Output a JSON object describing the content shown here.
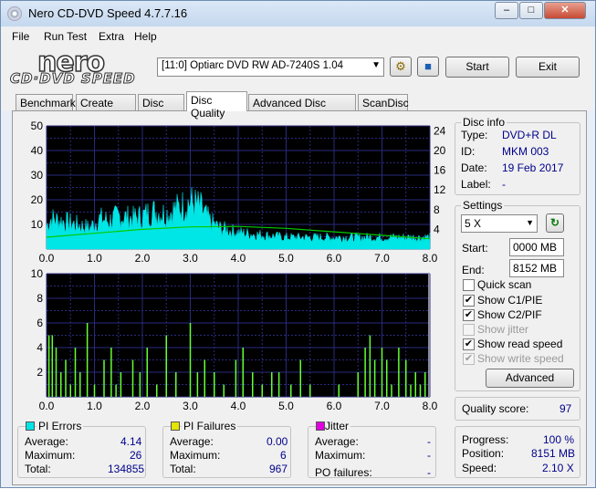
{
  "window": {
    "title": "Nero CD-DVD Speed 4.7.7.16",
    "min": "‒",
    "max": "□",
    "close": "✕"
  },
  "menu": [
    "File",
    "Run Test",
    "Extra",
    "Help"
  ],
  "logo": {
    "brand": "nero",
    "sub": "CD·DVD SPEED"
  },
  "toolbar": {
    "drive": "[11:0]   Optiarc DVD RW AD-7240S 1.04",
    "start": "Start",
    "exit": "Exit"
  },
  "tabs": [
    "Benchmark",
    "Create Disc",
    "Disc Info",
    "Disc Quality",
    "Advanced Disc Quality",
    "ScanDisc"
  ],
  "active_tab": "Disc Quality",
  "disc_info": {
    "title": "Disc info",
    "type_label": "Type:",
    "type": "DVD+R DL",
    "id_label": "ID:",
    "id": "MKM 003",
    "date_label": "Date:",
    "date": "19 Feb 2017",
    "label_label": "Label:",
    "label": "-"
  },
  "settings": {
    "title": "Settings",
    "speed": "5 X",
    "start_label": "Start:",
    "start": "0000 MB",
    "end_label": "End:",
    "end": "8152 MB",
    "quick_scan": "Quick scan",
    "show_c1pie": "Show C1/PIE",
    "show_c2pif": "Show C2/PIF",
    "show_jitter": "Show jitter",
    "show_read_speed": "Show read speed",
    "show_write_speed": "Show write speed",
    "advanced": "Advanced"
  },
  "checks": {
    "quick_scan": false,
    "c1pie": true,
    "c2pif": true,
    "jitter": false,
    "read_speed": true,
    "write_speed": true
  },
  "quality": {
    "label": "Quality score:",
    "value": "97"
  },
  "progress": {
    "progress_label": "Progress:",
    "progress": "100 %",
    "position_label": "Position:",
    "position": "8151 MB",
    "speed_label": "Speed:",
    "speed": "2.10 X"
  },
  "pi_errors": {
    "title": "PI Errors",
    "color": "#00e5e5",
    "avg_label": "Average:",
    "avg": "4.14",
    "max_label": "Maximum:",
    "max": "26",
    "total_label": "Total:",
    "total": "134855"
  },
  "pi_failures": {
    "title": "PI Failures",
    "color": "#e5e500",
    "avg_label": "Average:",
    "avg": "0.00",
    "max_label": "Maximum:",
    "max": "6",
    "total_label": "Total:",
    "total": "967"
  },
  "jitter": {
    "title": "Jitter",
    "color": "#e000e0",
    "avg_label": "Average:",
    "avg": "-",
    "max_label": "Maximum:",
    "max": "-",
    "po_label": "PO failures:",
    "po": "-"
  },
  "chart_data": [
    {
      "type": "area",
      "series": [
        {
          "name": "PI Errors",
          "color": "#00e5e5"
        },
        {
          "name": "Read speed",
          "color": "#00cc00"
        }
      ],
      "x_ticks": [
        "0.0",
        "1.0",
        "2.0",
        "3.0",
        "4.0",
        "5.0",
        "6.0",
        "7.0",
        "8.0"
      ],
      "y_ticks_left": [
        "10",
        "20",
        "30",
        "40",
        "50"
      ],
      "y_ticks_right": [
        "4",
        "8",
        "12",
        "16",
        "20",
        "24"
      ],
      "xlim": [
        0,
        8
      ],
      "ylim": [
        0,
        50
      ],
      "ylim_right": [
        0,
        25
      ],
      "pi_profile": [
        [
          0,
          10
        ],
        [
          0.1,
          13
        ],
        [
          0.3,
          12
        ],
        [
          0.5,
          11
        ],
        [
          0.7,
          10
        ],
        [
          0.9,
          9
        ],
        [
          1.1,
          13
        ],
        [
          1.3,
          12
        ],
        [
          1.5,
          14
        ],
        [
          1.8,
          13
        ],
        [
          2.0,
          14
        ],
        [
          2.2,
          16
        ],
        [
          2.5,
          15
        ],
        [
          2.8,
          18
        ],
        [
          3.0,
          20
        ],
        [
          3.2,
          18
        ],
        [
          3.4,
          12
        ],
        [
          3.6,
          9
        ],
        [
          3.8,
          8
        ],
        [
          4.0,
          7
        ],
        [
          4.5,
          6
        ],
        [
          5.0,
          5
        ],
        [
          5.5,
          5
        ],
        [
          6.0,
          5
        ],
        [
          6.5,
          5
        ],
        [
          7.0,
          5
        ],
        [
          7.5,
          5
        ],
        [
          8.0,
          5
        ]
      ],
      "read_speed": [
        [
          0,
          2.4
        ],
        [
          1,
          3.2
        ],
        [
          2,
          4.0
        ],
        [
          3,
          4.5
        ],
        [
          4,
          4.6
        ],
        [
          5,
          4.2
        ],
        [
          6,
          3.5
        ],
        [
          7,
          2.8
        ],
        [
          8,
          2.1
        ]
      ]
    },
    {
      "type": "bar",
      "series": [
        {
          "name": "PI Failures",
          "color": "#66ff33"
        }
      ],
      "x_ticks": [
        "0.0",
        "1.0",
        "2.0",
        "3.0",
        "4.0",
        "5.0",
        "6.0",
        "7.0",
        "8.0"
      ],
      "y_ticks": [
        "2",
        "4",
        "6",
        "8",
        "10"
      ],
      "xlim": [
        0,
        8
      ],
      "ylim": [
        0,
        10
      ],
      "spikes": [
        [
          0.05,
          5
        ],
        [
          0.12,
          5
        ],
        [
          0.2,
          4
        ],
        [
          0.3,
          2
        ],
        [
          0.4,
          3
        ],
        [
          0.5,
          1
        ],
        [
          0.6,
          4
        ],
        [
          0.7,
          2
        ],
        [
          0.85,
          6
        ],
        [
          1.0,
          1
        ],
        [
          1.2,
          3
        ],
        [
          1.35,
          4
        ],
        [
          1.45,
          1
        ],
        [
          1.55,
          2
        ],
        [
          1.8,
          3
        ],
        [
          1.95,
          2
        ],
        [
          2.1,
          4
        ],
        [
          2.3,
          1
        ],
        [
          2.5,
          5
        ],
        [
          2.7,
          2
        ],
        [
          3.0,
          6
        ],
        [
          3.15,
          2
        ],
        [
          3.3,
          3
        ],
        [
          3.5,
          2
        ],
        [
          3.7,
          1
        ],
        [
          3.95,
          3
        ],
        [
          4.1,
          4
        ],
        [
          4.3,
          2
        ],
        [
          4.5,
          1
        ],
        [
          4.7,
          2
        ],
        [
          4.85,
          2
        ],
        [
          5.1,
          1
        ],
        [
          5.3,
          3
        ],
        [
          5.5,
          1
        ],
        [
          6.1,
          1
        ],
        [
          6.5,
          2
        ],
        [
          6.65,
          4
        ],
        [
          6.75,
          5
        ],
        [
          6.85,
          3
        ],
        [
          7.0,
          4
        ],
        [
          7.1,
          3
        ],
        [
          7.2,
          1
        ],
        [
          7.35,
          4
        ],
        [
          7.5,
          3
        ],
        [
          7.6,
          1
        ],
        [
          7.7,
          2
        ],
        [
          7.8,
          1
        ],
        [
          7.9,
          2
        ]
      ]
    }
  ]
}
